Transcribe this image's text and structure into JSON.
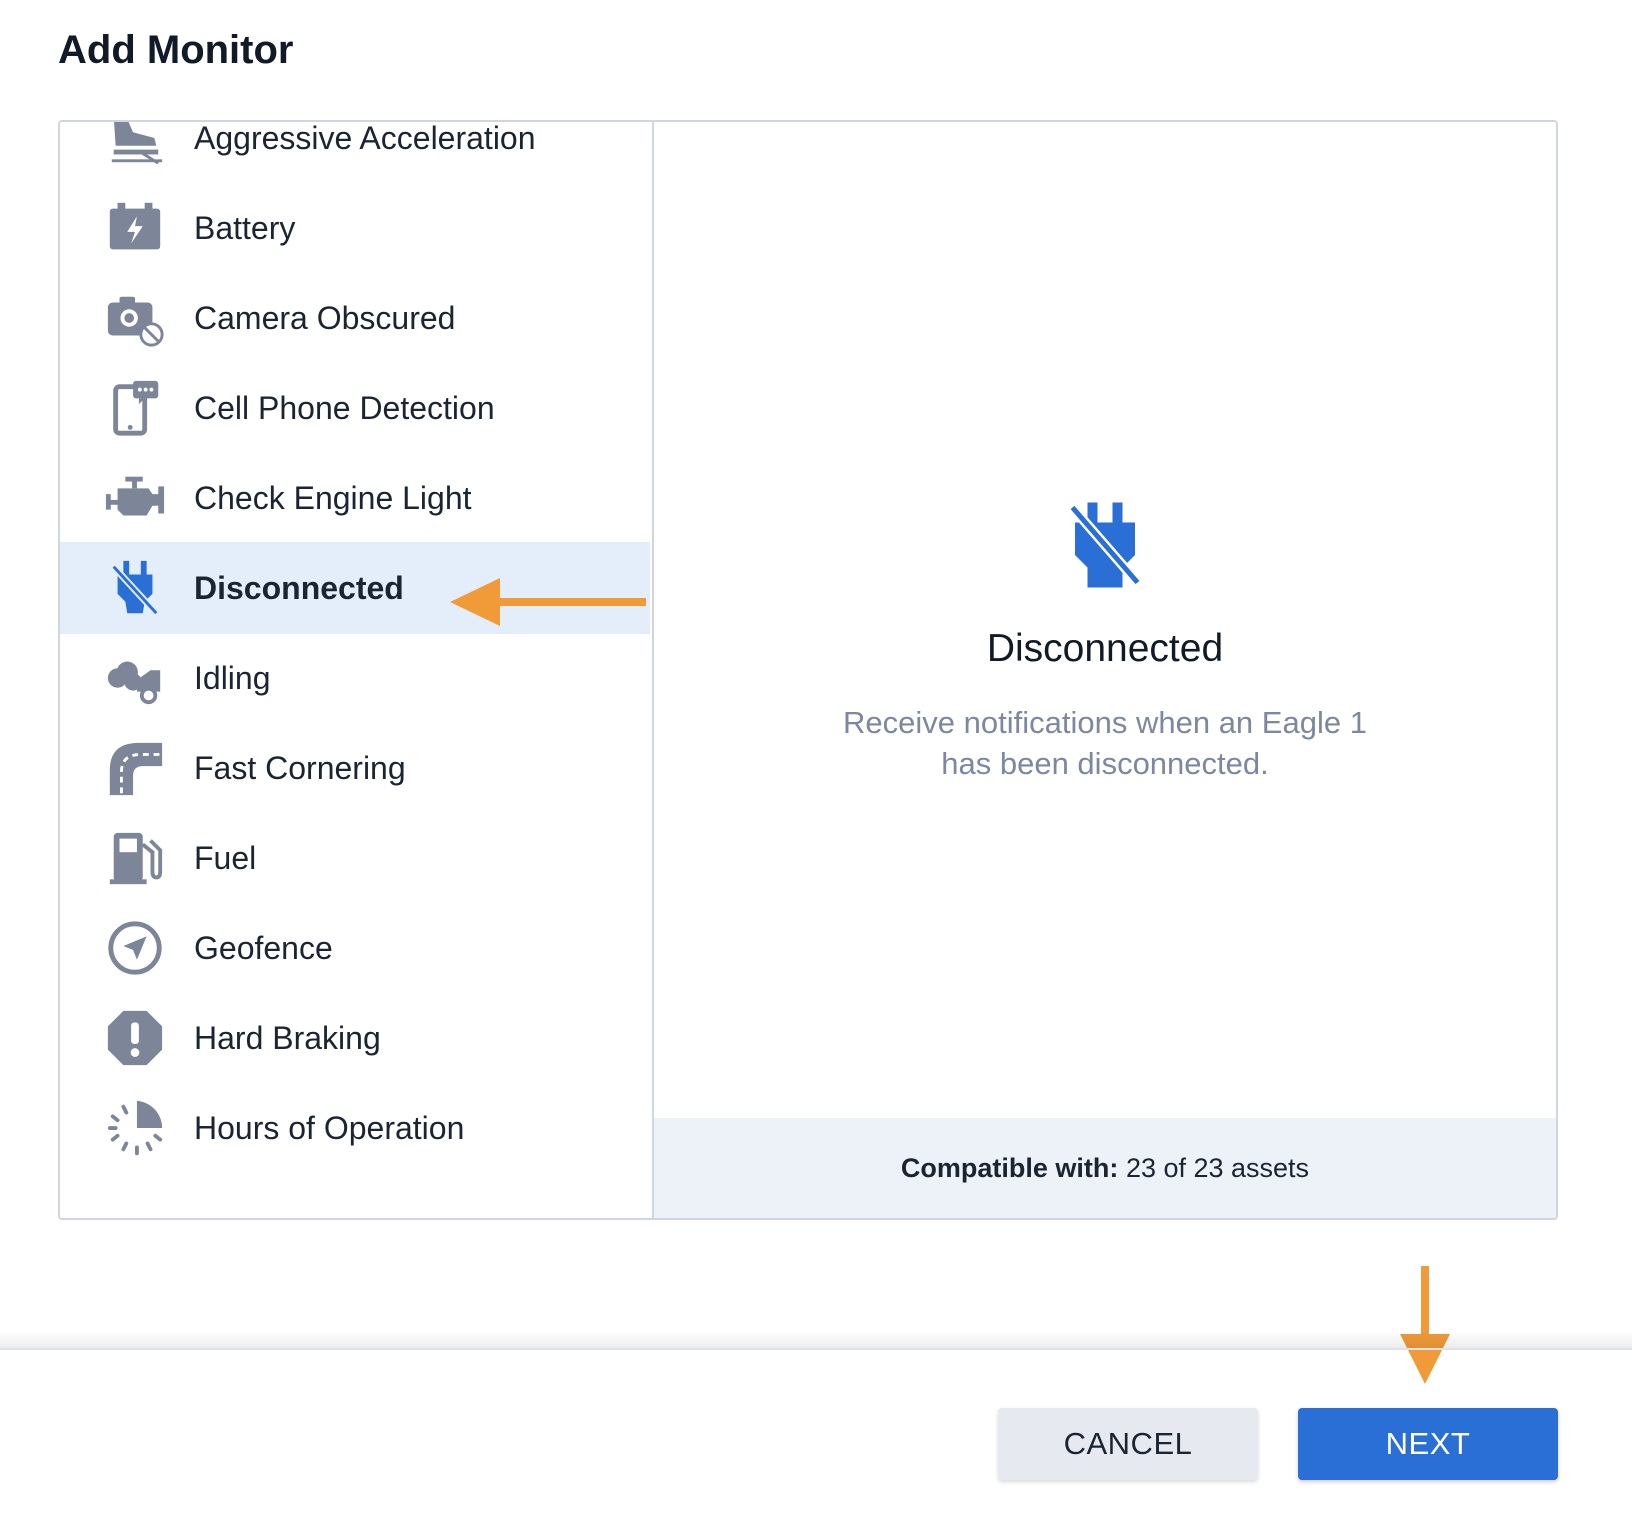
{
  "dialog": {
    "title": "Add Monitor"
  },
  "monitors": [
    {
      "label": "Aggressive Acceleration",
      "icon": "pedal-icon"
    },
    {
      "label": "Battery",
      "icon": "battery-icon"
    },
    {
      "label": "Camera Obscured",
      "icon": "camera-obscured-icon"
    },
    {
      "label": "Cell Phone Detection",
      "icon": "cell-phone-icon"
    },
    {
      "label": "Check Engine Light",
      "icon": "engine-icon"
    },
    {
      "label": "Disconnected",
      "icon": "disconnected-plug-icon",
      "selected": true
    },
    {
      "label": "Idling",
      "icon": "idling-icon"
    },
    {
      "label": "Fast Cornering",
      "icon": "road-curve-icon"
    },
    {
      "label": "Fuel",
      "icon": "fuel-pump-icon"
    },
    {
      "label": "Geofence",
      "icon": "navigation-icon"
    },
    {
      "label": "Hard Braking",
      "icon": "warning-octagon-icon"
    },
    {
      "label": "Hours of Operation",
      "icon": "clock-partial-icon"
    }
  ],
  "detail": {
    "title": "Disconnected",
    "description": "Receive notifications when an Eagle 1 has been disconnected.",
    "compatible_label": "Compatible with:",
    "compatible_value": "23 of 23 assets",
    "icon": "disconnected-plug-icon"
  },
  "footer": {
    "cancel_label": "CANCEL",
    "next_label": "NEXT"
  },
  "colors": {
    "accent": "#2a6fd6",
    "annotation_arrow": "#f09a38",
    "icon_gray": "#7d8699",
    "selected_bg": "#e4eefb"
  }
}
